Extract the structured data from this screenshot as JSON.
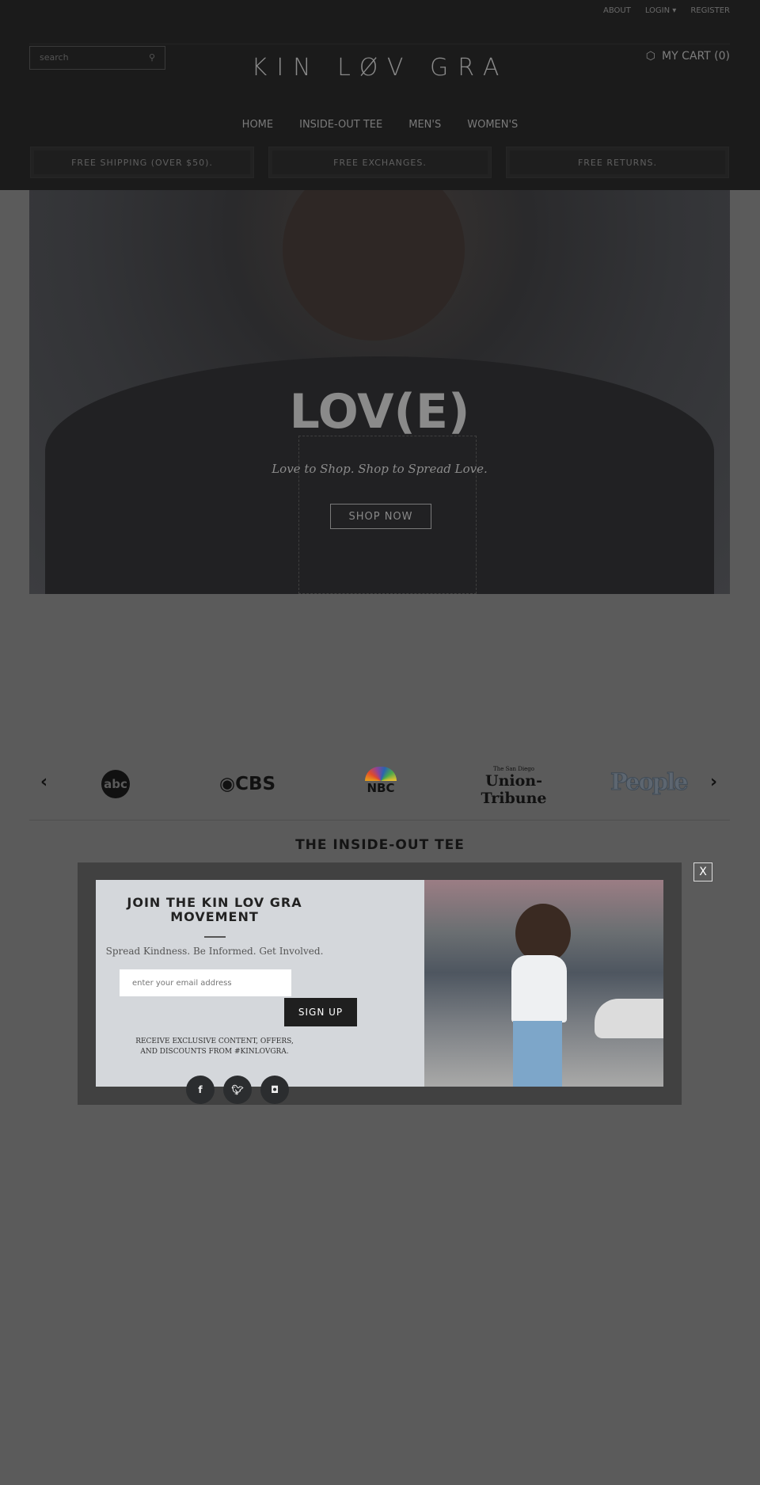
{
  "header": {
    "top_links": [
      "ABOUT",
      "LOGIN",
      "REGISTER"
    ],
    "search_placeholder": "search",
    "logo": "KIN LØV GRA",
    "cart": "MY CART (0)",
    "nav": [
      "HOME",
      "INSIDE-OUT TEE",
      "MEN'S",
      "WOMEN'S"
    ],
    "perks": [
      "FREE SHIPPING (OVER $50).",
      "FREE EXCHANGES.",
      "FREE RETURNS."
    ]
  },
  "hero": {
    "title": "LOV(E)",
    "subtitle": "Love to Shop. Shop to Spread Love.",
    "button": "SHOP NOW"
  },
  "press": {
    "logos": [
      "abc",
      "CBS",
      "NBC",
      "Union-Tribune",
      "People"
    ],
    "ut_small": "The San Diego"
  },
  "section": {
    "title": "THE INSIDE-OUT TEE"
  },
  "modal": {
    "title": "JOIN THE KIN LOV GRA MOVEMENT",
    "subtitle": "Spread Kindness. Be Informed. Get Involved.",
    "email_placeholder": "enter your email address",
    "signup": "SIGN UP",
    "fine_print": "RECEIVE EXCLUSIVE CONTENT, OFFERS, AND DISCOUNTS FROM #KINLOVGRA.",
    "close": "X",
    "social": [
      "f",
      "t",
      "ig"
    ]
  }
}
